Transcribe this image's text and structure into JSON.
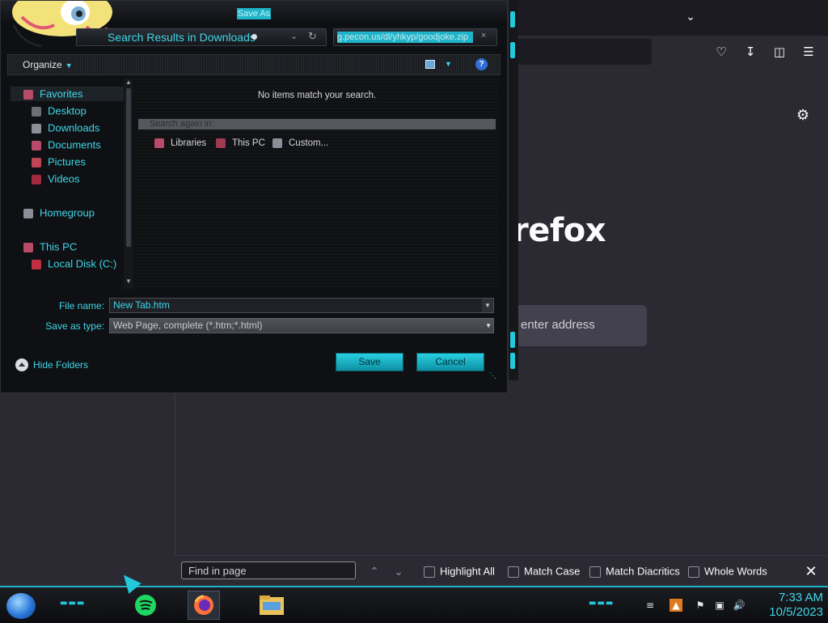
{
  "firefox": {
    "brand_fragment": "refox",
    "search_placeholder_fragment": "enter address",
    "findbar": {
      "input_placeholder": "Find in page",
      "options": [
        {
          "label": "Highlight All"
        },
        {
          "label": "Match Case"
        },
        {
          "label": "Match Diacritics"
        },
        {
          "label": "Whole Words"
        }
      ]
    }
  },
  "dialog": {
    "title": "Save As",
    "address": "Search Results in Downloads",
    "url_fragment": "g.pecon.us/dl/yhkyp/goodjoke.zip",
    "toolbar": {
      "organize": "Organize"
    },
    "nav": [
      {
        "label": "Favorites",
        "icon": "star-icon"
      },
      {
        "label": "Desktop",
        "icon": "desktop-icon"
      },
      {
        "label": "Downloads",
        "icon": "downloads-icon"
      },
      {
        "label": "Documents",
        "icon": "documents-icon"
      },
      {
        "label": "Pictures",
        "icon": "pictures-icon"
      },
      {
        "label": "Videos",
        "icon": "videos-icon"
      },
      {
        "label": "Homegroup",
        "icon": "homegroup-icon"
      },
      {
        "label": "This PC",
        "icon": "pc-icon"
      },
      {
        "label": "Local Disk (C:)",
        "icon": "disk-icon"
      }
    ],
    "content": {
      "empty_message": "No items match your search.",
      "search_again": "Search again in:",
      "locations": [
        {
          "label": "Libraries"
        },
        {
          "label": "This PC"
        },
        {
          "label": "Custom..."
        }
      ]
    },
    "file_name_label": "File name:",
    "file_name_value": "New Tab.htm",
    "save_type_label": "Save as type:",
    "save_type_value": "Web Page, complete (*.htm;*.html)",
    "hide_folders": "Hide Folders",
    "save_button": "Save",
    "cancel_button": "Cancel"
  },
  "taskbar": {
    "time": "7:33 AM",
    "date": "10/5/2023"
  },
  "colors": {
    "accent_cyan": "#3fd6e8",
    "button_cyan": "#1fb4c9",
    "firefox_bg": "#2b2a33"
  }
}
